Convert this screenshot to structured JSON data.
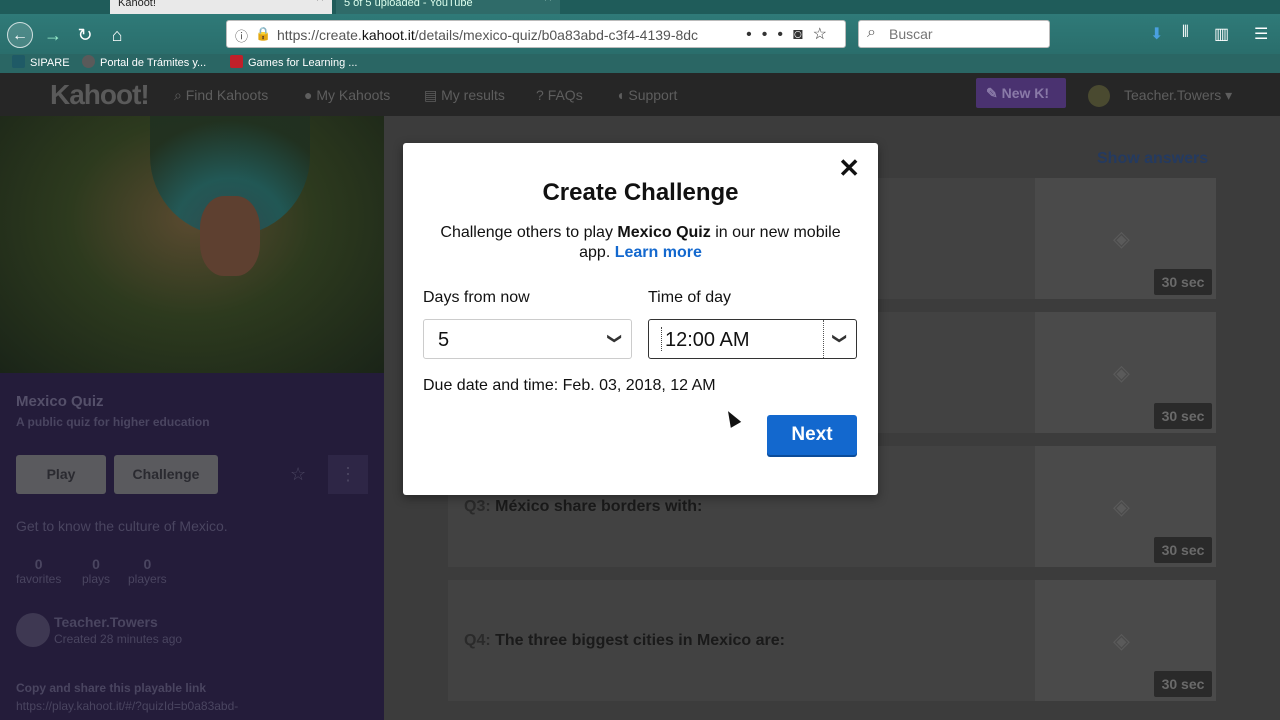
{
  "browser": {
    "tabs": [
      {
        "title": "Kahoot!"
      },
      {
        "title": "5 of 5 uploaded - YouTube"
      }
    ],
    "url": {
      "prefix": "https://create.",
      "domain": "kahoot.it",
      "path": "/details/mexico-quiz/b0a83abd-c3f4-4139-8dc"
    },
    "search_placeholder": "Buscar",
    "bookmarks": [
      {
        "label": "SIPARE",
        "color": "#1f5a66"
      },
      {
        "label": "Portal de Trámites y...",
        "color": "#5a5a5a"
      },
      {
        "label": "Games for Learning ...",
        "color": "#c0202a"
      }
    ]
  },
  "kahoot_header": {
    "logo": "Kahoot!",
    "nav": [
      {
        "icon": "search-icon",
        "label": "Find Kahoots"
      },
      {
        "icon": "user-icon",
        "label": "My Kahoots"
      },
      {
        "icon": "list-icon",
        "label": "My results"
      },
      {
        "icon": "question-icon",
        "label": "FAQs"
      },
      {
        "icon": "chat-icon",
        "label": "Support"
      }
    ],
    "new_button": "New K!",
    "username": "Teacher.Towers"
  },
  "quiz": {
    "title": "Mexico Quiz",
    "subtitle": "A public quiz for higher education",
    "play_label": "Play",
    "challenge_label": "Challenge",
    "description": "Get to know the culture of Mexico.",
    "stats": [
      {
        "value": "0",
        "label": "favorites"
      },
      {
        "value": "0",
        "label": "plays"
      },
      {
        "value": "0",
        "label": "players"
      }
    ],
    "creator": "Teacher.Towers",
    "created": "Created 28 minutes ago",
    "share_label": "Copy and share this playable link",
    "share_link": "https://play.kahoot.it/#/?quizId=b0a83abd-"
  },
  "questions_panel": {
    "show_answers": "Show answers",
    "questions": [
      {
        "num": "",
        "text": "",
        "time": "30 sec"
      },
      {
        "num": "",
        "text": "",
        "time": "30 sec"
      },
      {
        "num": "Q3:",
        "text": "México share borders with:",
        "time": "30 sec"
      },
      {
        "num": "Q4:",
        "text": "The three biggest cities in Mexico are:",
        "time": "30 sec"
      }
    ]
  },
  "modal": {
    "title": "Create Challenge",
    "body_before": "Challenge others to play ",
    "body_quiz": "Mexico Quiz",
    "body_after": " in our new mobile app. ",
    "learn_more": "Learn more",
    "days_label": "Days from now",
    "days_value": "5",
    "time_label": "Time of day",
    "time_value": "12:00 AM",
    "due_date": "Due date and time: Feb. 03, 2018, 12 AM",
    "next_label": "Next"
  },
  "colors": {
    "kahoot_blue": "#1368ce",
    "left_panel_bg": "#241c3a",
    "browser_teal": "#2a6e6c"
  }
}
